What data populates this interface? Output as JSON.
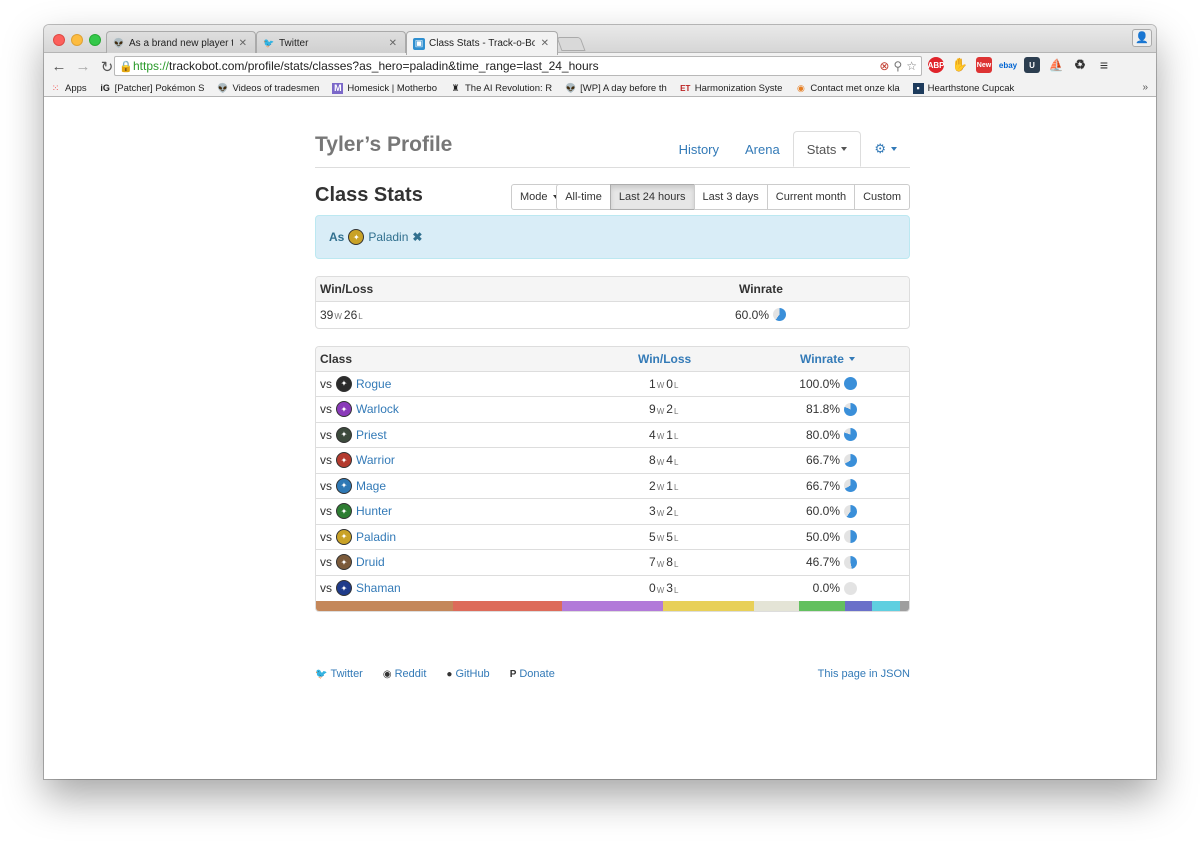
{
  "browser": {
    "tabs": [
      {
        "title": "As a brand new player this",
        "icon": "reddit-icon"
      },
      {
        "title": "Twitter",
        "icon": "twitter-icon"
      },
      {
        "title": "Class Stats - Track-o-Bot",
        "icon": "trackobot-icon"
      }
    ],
    "url_https": "https://",
    "url_rest": "trackobot.com/profile/stats/classes?as_hero=paladin&time_range=last_24_hours",
    "bookmarks": [
      {
        "label": "Apps",
        "icon": "apps-grid-icon"
      },
      {
        "label": "[Patcher] Pokémon S",
        "icon": "ign-icon"
      },
      {
        "label": "Videos of tradesmen",
        "icon": "reddit-icon"
      },
      {
        "label": "Homesick | Motherbo",
        "icon": "m-icon"
      },
      {
        "label": "The AI Revolution: R",
        "icon": "waitbutwhy-icon"
      },
      {
        "label": "[WP] A day before th",
        "icon": "reddit-icon"
      },
      {
        "label": "Harmonization Syste",
        "icon": "et-icon"
      },
      {
        "label": "Contact met onze kla",
        "icon": "contact-icon"
      },
      {
        "label": "Hearthstone Cupcak",
        "icon": "hearthstone-icon"
      }
    ],
    "bookmarks_more": "»"
  },
  "profile": {
    "title": "Tyler’s Profile",
    "tabs": [
      "History",
      "Arena",
      "Stats"
    ]
  },
  "stats": {
    "title": "Class Stats",
    "mode_label": "Mode",
    "time_ranges": [
      "All-time",
      "Last 24 hours",
      "Last 3 days",
      "Current month",
      "Custom"
    ],
    "active_range": "Last 24 hours",
    "filter_as": "As",
    "filter_hero": "Paladin",
    "filter_remove": "✖"
  },
  "summary": {
    "headers": {
      "winloss": "Win/Loss",
      "winrate": "Winrate"
    },
    "wins": "39",
    "losses": "26",
    "w": "W",
    "l": "L",
    "winrate": "60.0%",
    "winrate_value": 60.0
  },
  "classes": {
    "headers": {
      "class": "Class",
      "winloss": "Win/Loss",
      "winrate": "Winrate"
    },
    "vs": "vs",
    "rows": [
      {
        "name": "Rogue",
        "wins": "1",
        "losses": "0",
        "winrate": "100.0%",
        "winrate_value": 100.0,
        "color": "#2c2c2c"
      },
      {
        "name": "Warlock",
        "wins": "9",
        "losses": "2",
        "winrate": "81.8%",
        "winrate_value": 81.8,
        "color": "#8a3ab9"
      },
      {
        "name": "Priest",
        "wins": "4",
        "losses": "1",
        "winrate": "80.0%",
        "winrate_value": 80.0,
        "color": "#3c4a3c"
      },
      {
        "name": "Warrior",
        "wins": "8",
        "losses": "4",
        "winrate": "66.7%",
        "winrate_value": 66.7,
        "color": "#b33a2e"
      },
      {
        "name": "Mage",
        "wins": "2",
        "losses": "1",
        "winrate": "66.7%",
        "winrate_value": 66.7,
        "color": "#2f79b5"
      },
      {
        "name": "Hunter",
        "wins": "3",
        "losses": "2",
        "winrate": "60.0%",
        "winrate_value": 60.0,
        "color": "#2e7d32"
      },
      {
        "name": "Paladin",
        "wins": "5",
        "losses": "5",
        "winrate": "50.0%",
        "winrate_value": 50.0,
        "color": "#c9a227"
      },
      {
        "name": "Druid",
        "wins": "7",
        "losses": "8",
        "winrate": "46.7%",
        "winrate_value": 46.7,
        "color": "#7b5a3a"
      },
      {
        "name": "Shaman",
        "wins": "0",
        "losses": "3",
        "winrate": "0.0%",
        "winrate_value": 0.0,
        "color": "#1f3b8a"
      }
    ],
    "distribution": [
      {
        "games": 15,
        "color": "#c4875a"
      },
      {
        "games": 12,
        "color": "#dd6b5a"
      },
      {
        "games": 11,
        "color": "#b27ad9"
      },
      {
        "games": 10,
        "color": "#e8d058"
      },
      {
        "games": 5,
        "color": "#e4e4d6"
      },
      {
        "games": 5,
        "color": "#63c05f"
      },
      {
        "games": 3,
        "color": "#6a70c9"
      },
      {
        "games": 3,
        "color": "#5fcfe0"
      },
      {
        "games": 1,
        "color": "#9e9e9e"
      }
    ]
  },
  "footer": {
    "links": [
      {
        "label": "Twitter",
        "icon": "twitter-icon"
      },
      {
        "label": "Reddit",
        "icon": "reddit-icon"
      },
      {
        "label": "GitHub",
        "icon": "github-icon"
      },
      {
        "label": "Donate",
        "icon": "paypal-icon"
      }
    ],
    "json_link": "This page in JSON"
  }
}
